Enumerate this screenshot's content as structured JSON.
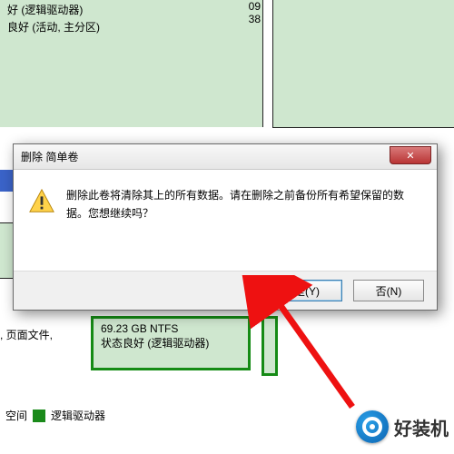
{
  "bg": {
    "row1": "好 (逻辑驱动器)",
    "row2": "良好 (活动, 主分区)",
    "col_top": "09",
    "col_bot": "38"
  },
  "partition": {
    "size": "69.23 GB NTFS",
    "status": "状态良好 (逻辑驱动器)"
  },
  "left_text": ", 页面文件,",
  "legend": {
    "label": "逻辑驱动器",
    "prefix": "空间"
  },
  "dialog": {
    "title": "删除 简单卷",
    "message": "删除此卷将清除其上的所有数据。请在删除之前备份所有希望保留的数据。您想继续吗？",
    "yes": "是(Y)",
    "no": "否(N)",
    "close_x": "✕"
  },
  "watermark": "好装机"
}
